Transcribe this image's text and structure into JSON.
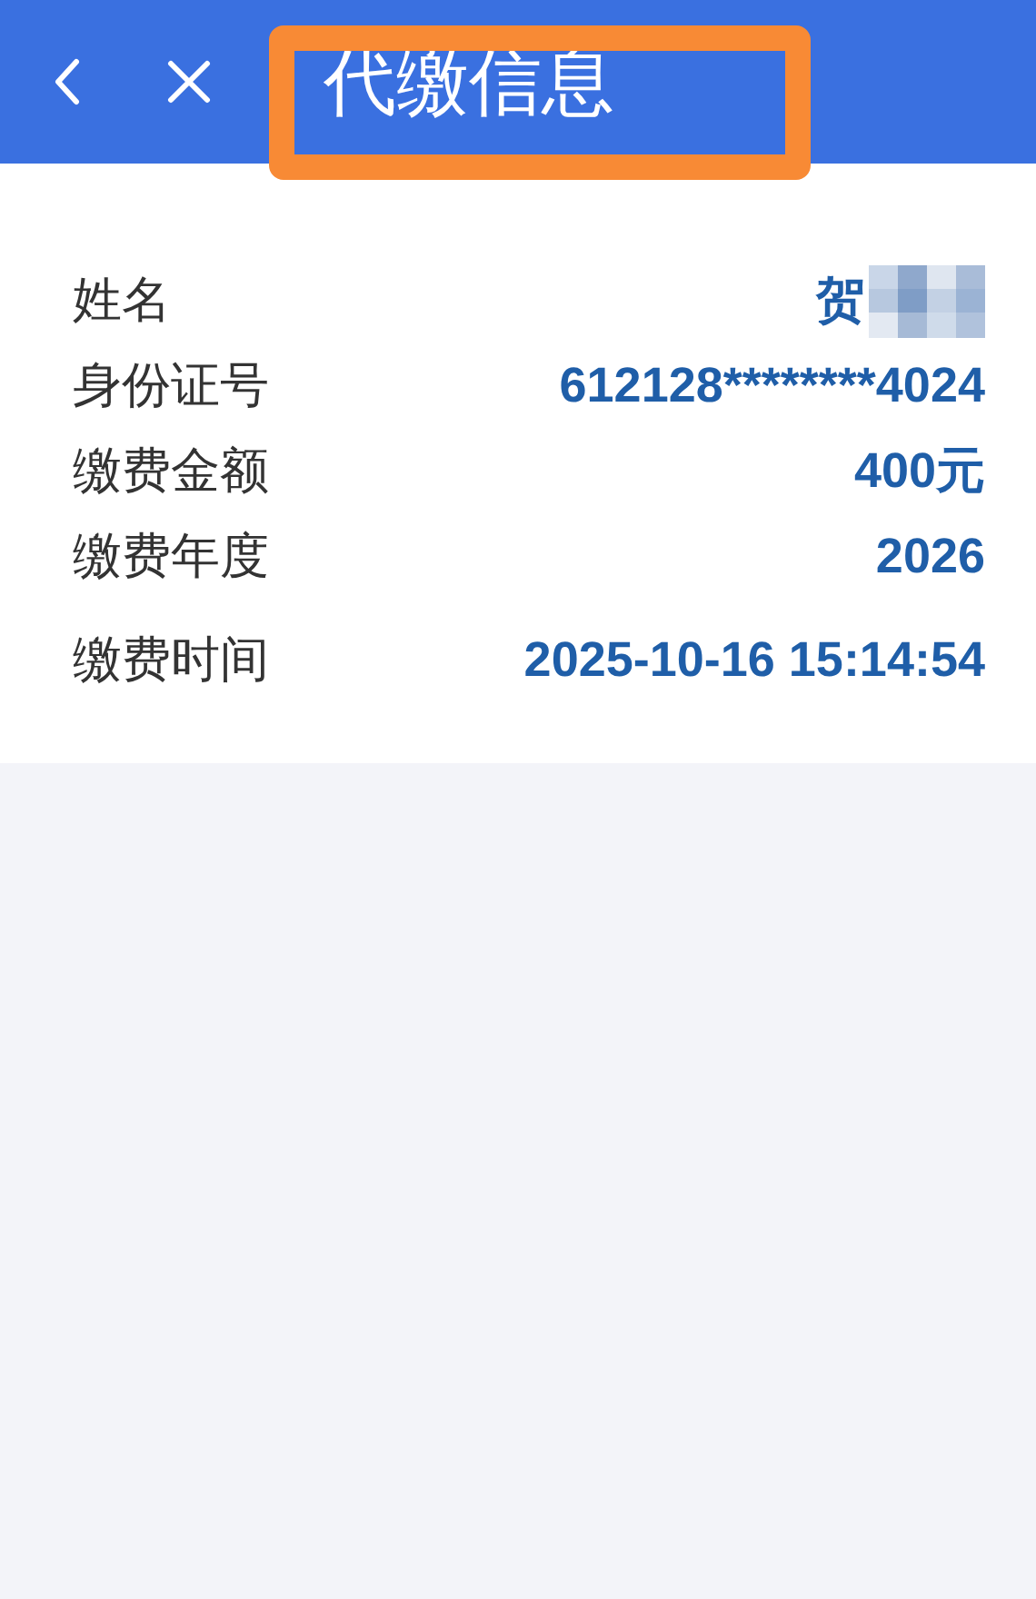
{
  "header": {
    "title": "代缴信息",
    "title_highlighted": true
  },
  "fields": [
    {
      "label": "姓名",
      "value": "贺",
      "kind": "masked"
    },
    {
      "label": "身份证号",
      "value": "612128********4024",
      "kind": "plain"
    },
    {
      "label": "缴费金额",
      "value": "400元",
      "kind": "plain"
    },
    {
      "label": "缴费年度",
      "value": "2026",
      "kind": "plain"
    },
    {
      "label": "缴费时间",
      "value": "2025-10-16 15:14:54",
      "kind": "plain"
    }
  ]
}
